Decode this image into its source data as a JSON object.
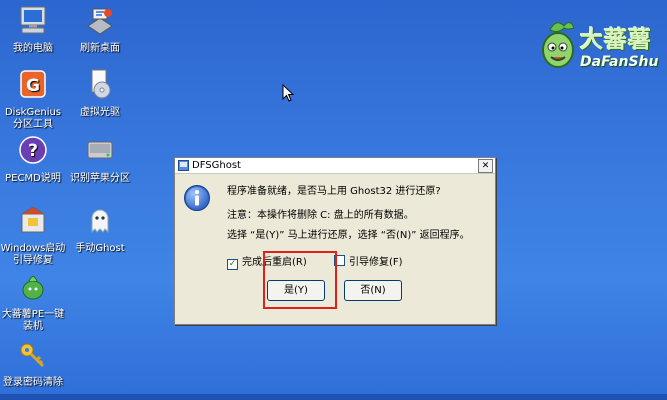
{
  "desktop_icons": [
    {
      "label": "我的电脑",
      "icon": "my-computer-icon"
    },
    {
      "label": "刷新桌面",
      "icon": "refresh-desktop-icon"
    },
    {
      "label": "DiskGenius分区工具",
      "icon": "diskgenius-icon"
    },
    {
      "label": "虚拟光驱",
      "icon": "virtual-cdrom-icon"
    },
    {
      "label": "PECMD说明",
      "icon": "help-icon"
    },
    {
      "label": "识别苹果分区",
      "icon": "disk-icon"
    },
    {
      "label": "Windows启动引导修复",
      "icon": "boot-repair-icon"
    },
    {
      "label": "手动Ghost",
      "icon": "ghost-icon"
    },
    {
      "label": "大蕃薯PE一键装机",
      "icon": "installer-icon"
    },
    {
      "label": "登录密码清除",
      "icon": "key-icon"
    }
  ],
  "logo": {
    "title": "大蕃薯",
    "subtitle": "DaFanShu"
  },
  "dialog": {
    "title": "DFSGhost",
    "close_glyph": "✕",
    "line1": "程序准备就绪，是否马上用 Ghost32 进行还原?",
    "line2": "注意：本操作将删除 C: 盘上的所有数据。",
    "line3": "选择 “是(Y)” 马上进行还原，选择 “否(N)” 返回程序。",
    "checkbox_restart": {
      "label": "完成后重启(R)",
      "checked": true
    },
    "checkbox_bootfix": {
      "label": "引导修复(F)",
      "checked": false
    },
    "yes_label": "是(Y)",
    "no_label": "否(N)"
  },
  "colors": {
    "highlight": "#e0201a",
    "desktop": "#3a7be0"
  }
}
